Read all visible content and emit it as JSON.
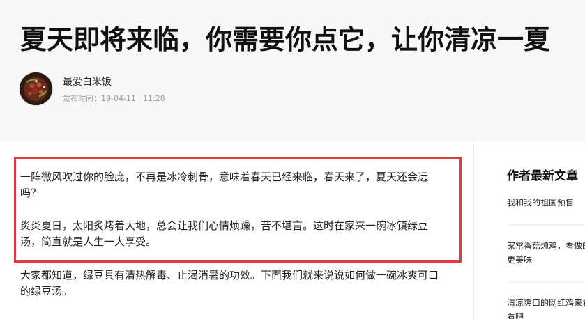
{
  "article": {
    "title": "夏天即将来临，你需要你点它，让你清凉一夏",
    "author": {
      "name": "最爱白米饭",
      "avatar_icon": "author-avatar-food-photo"
    },
    "publish": {
      "label": "发布时间：",
      "date": "19-04-11",
      "time": "11:28"
    },
    "highlight_color": "#e03c3c",
    "paragraphs": [
      "一阵微风吹过你的脸庞，不再是冰冷刺骨，意味着春天已经来临，春天来了，夏天还会远吗？",
      "炎炎夏日，太阳炙烤着大地，总会让我们心情烦躁，苦不堪言。这时在家来一碗冰镇绿豆汤，简直就是人生一大享受。",
      "大家都知道，绿豆具有清热解毒、止渴消暑的功效。下面我们就来说说如何做一碗冰爽可口的绿豆汤。"
    ]
  },
  "sidebar": {
    "title": "作者最新文章",
    "items": [
      {
        "label": "我和我的祖国预售"
      },
      {
        "label": "家常香菇炖鸡，看做的更美味"
      },
      {
        "label": "清凉爽口的网红鸡来看看吧"
      }
    ]
  }
}
